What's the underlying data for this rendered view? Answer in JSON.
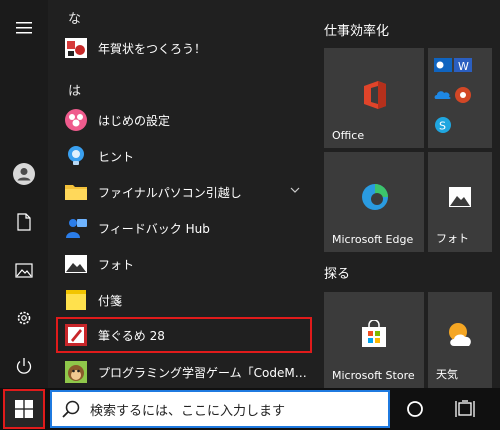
{
  "app_list": {
    "sections": [
      {
        "letter": "な",
        "items": [
          {
            "label": "年賀状をつくろう！",
            "icon": "nengajo-icon"
          }
        ]
      },
      {
        "letter": "は",
        "items": [
          {
            "label": "はじめの設定",
            "icon": "setup-icon"
          },
          {
            "label": "ヒント",
            "icon": "tips-icon"
          },
          {
            "label": "ファイナルパソコン引越し",
            "icon": "folder-icon",
            "expandable": true
          },
          {
            "label": "フィードバック Hub",
            "icon": "feedback-hub-icon"
          },
          {
            "label": "フォト",
            "icon": "photos-icon"
          },
          {
            "label": "付箋",
            "icon": "sticky-notes-icon"
          },
          {
            "label": "筆ぐるめ 28",
            "icon": "fudegurume-icon",
            "highlighted": true
          },
          {
            "label": "プログラミング学習ゲーム「CodeMonkey（…",
            "icon": "codemonkey-icon"
          }
        ]
      }
    ]
  },
  "tiles": {
    "groups": [
      {
        "title": "仕事効率化"
      },
      {
        "title": "探る"
      }
    ],
    "office_label": "Office",
    "edge_label": "Microsoft Edge",
    "photos_label": "フォト",
    "store_label": "Microsoft Store",
    "weather_label": "天気"
  },
  "taskbar": {
    "search_placeholder": "検索するには、ここに入力します"
  },
  "colors": {
    "highlight_border": "#e01b1b",
    "search_border": "#1f7ae0",
    "tile_bg": "#3b3b3b",
    "background": "#202020"
  }
}
